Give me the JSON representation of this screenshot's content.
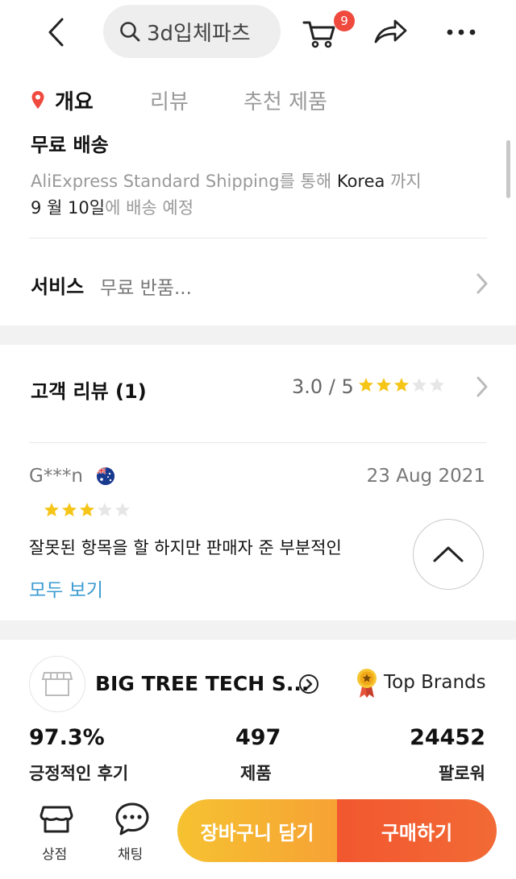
{
  "header": {
    "search_text": "3d입체파츠",
    "cart_count": "9",
    "icons": [
      "back-icon",
      "search-icon",
      "cart-icon",
      "share-icon",
      "more-icon"
    ]
  },
  "tabs": [
    {
      "label": "개요",
      "active": true
    },
    {
      "label": "리뷰",
      "active": false
    },
    {
      "label": "추천 제품",
      "active": false
    }
  ],
  "shipping": {
    "title": "무료 배송",
    "method": "AliExpress Standard Shipping",
    "via_text": "를 통해 ",
    "destination": "Korea",
    "to_text": " 까지",
    "date": "9 월 10일",
    "date_suffix": "에 배송 예정"
  },
  "service": {
    "title": "서비스",
    "value": "무료 반품..."
  },
  "reviews": {
    "title": "고객 리뷰 (1)",
    "rating_text": "3.0 / 5",
    "rating": 3,
    "max_rating": 5,
    "items": [
      {
        "reviewer": "G***n",
        "country": "Australia",
        "date": "23 Aug 2021",
        "rating": 3,
        "text": "잘못된 항목을 할 하지만 판매자 준 부분적인"
      }
    ],
    "view_all": "모두 보기"
  },
  "store": {
    "name": "BIG TREE TECH S...",
    "badge": "Top Brands",
    "stats": [
      {
        "value": "97.3%",
        "label": "긍정적인 후기"
      },
      {
        "value": "497",
        "label": "제품"
      },
      {
        "value": "24452",
        "label": "팔로워"
      }
    ]
  },
  "bottom_bar": {
    "store_label": "상점",
    "chat_label": "채팅",
    "add_to_cart": "장바구니 담기",
    "buy_now": "구매하기"
  },
  "colors": {
    "accent_red": "#f0493d",
    "star": "#f5c518",
    "link": "#3a9bd1",
    "cart_button": "#f6b633",
    "buy_button": "#f25f31"
  }
}
